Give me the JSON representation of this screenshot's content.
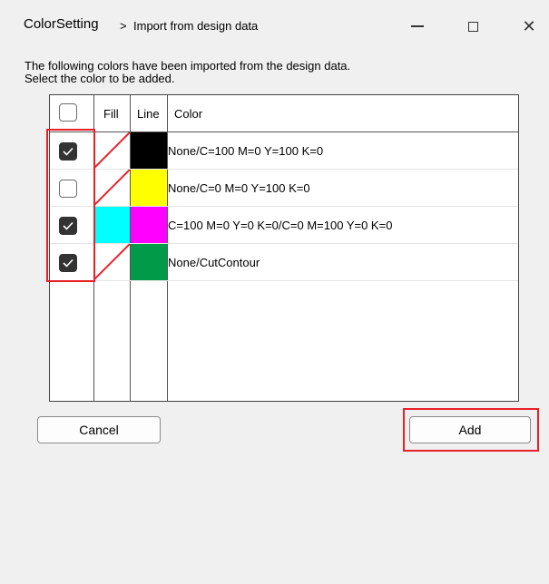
{
  "window": {
    "title": "ColorSetting",
    "separator": ">",
    "subtitle": "Import from design data"
  },
  "prompt": {
    "line1": "The following colors have been imported from the design data.",
    "line2": "Select the color to be added."
  },
  "table": {
    "headers": {
      "fill": "Fill",
      "line": "Line",
      "color": "Color"
    },
    "rows": [
      {
        "checked": true,
        "fill": "none",
        "line": "#000000",
        "color": "None/C=100 M=0 Y=100 K=0"
      },
      {
        "checked": false,
        "fill": "none",
        "line": "#ffff00",
        "color": "None/C=0 M=0 Y=100 K=0"
      },
      {
        "checked": true,
        "fill": "#00ffff",
        "line": "#ff00ff",
        "color": "C=100 M=0 Y=0 K=0/C=0 M=100 Y=0 K=0"
      },
      {
        "checked": true,
        "fill": "none",
        "line": "#009a48",
        "color": "None/CutContour"
      }
    ]
  },
  "buttons": {
    "cancel": "Cancel",
    "add": "Add"
  },
  "colors": {
    "highlight": "#e8202a",
    "none_slash": "#e8202a"
  }
}
